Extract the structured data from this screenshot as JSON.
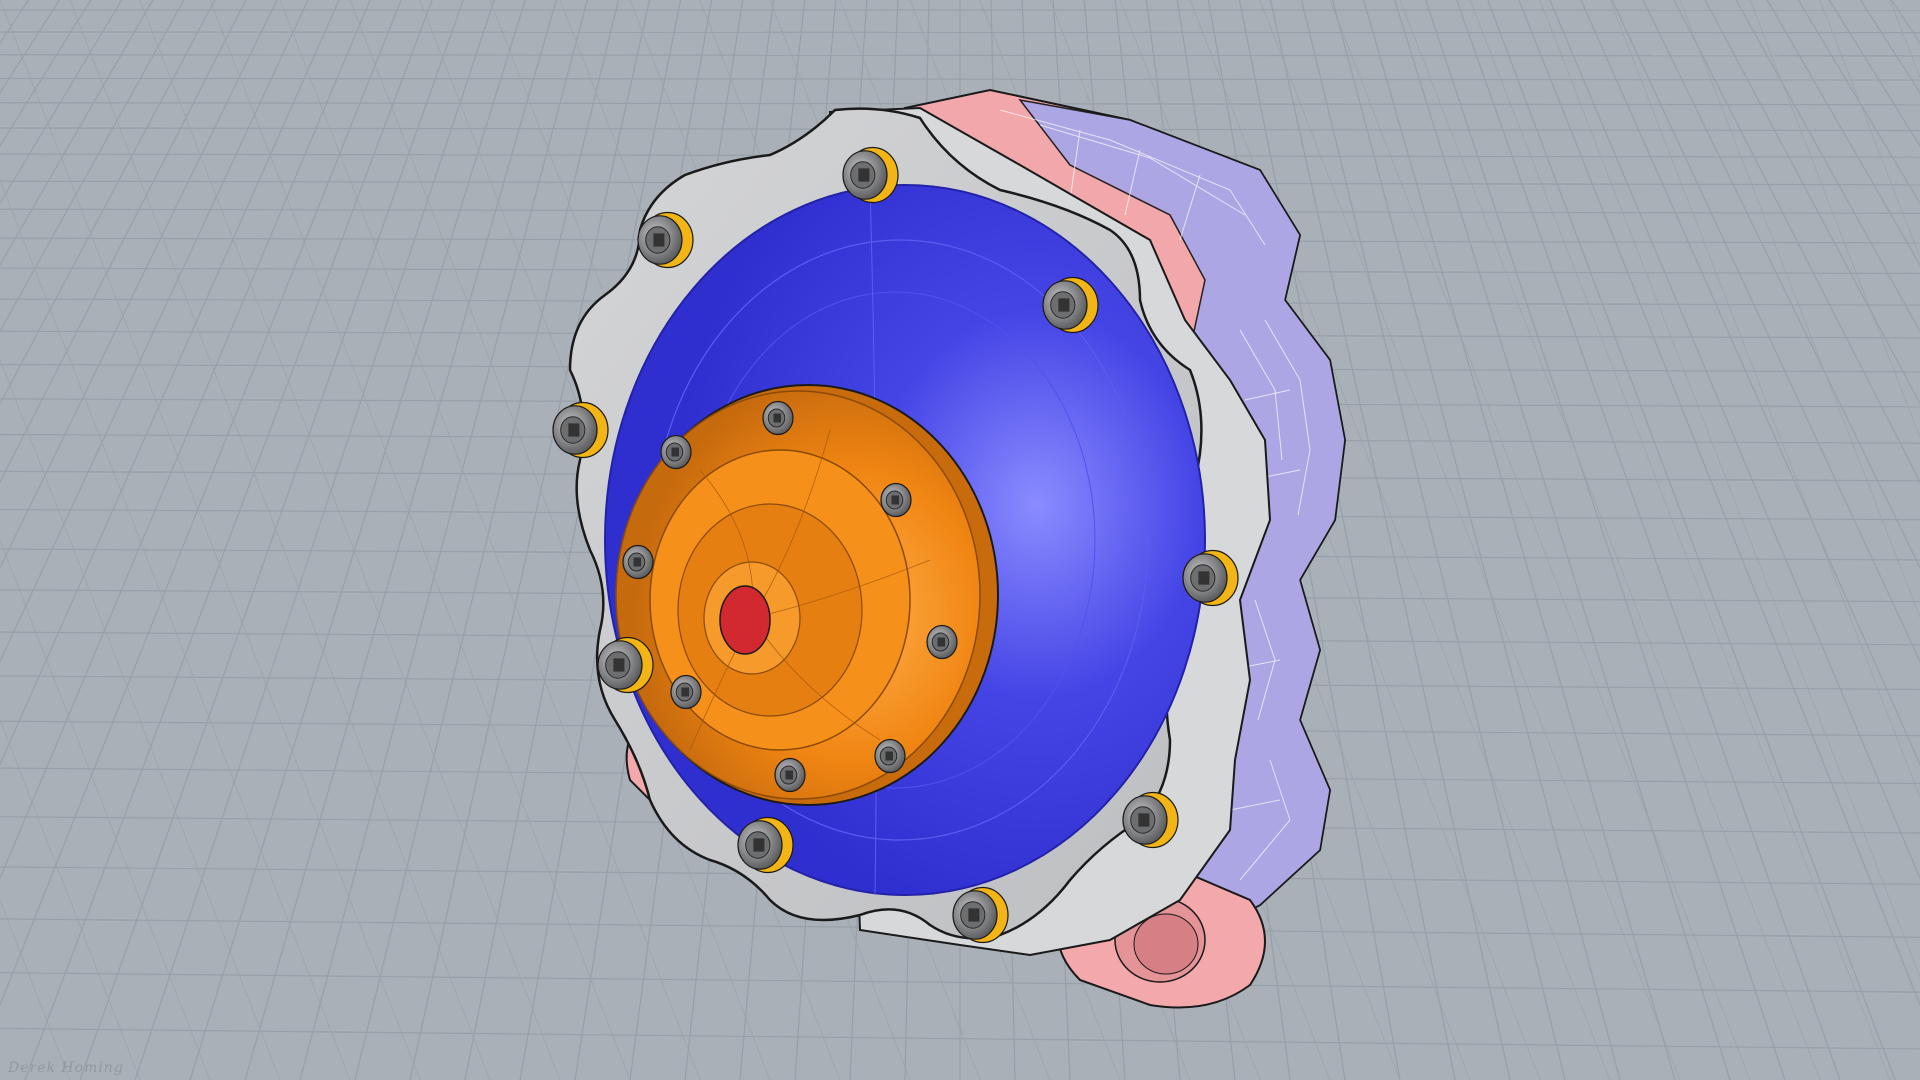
{
  "viewport": {
    "background": "#a9b0b7",
    "grid_color": "#8f969e",
    "grid_minor_color": "#9ea5ac"
  },
  "model": {
    "plate_color": "#c9cacc",
    "rotor_color": "#3535d8",
    "rotor_highlight": "#7a7cff",
    "hub_color": "#f28a14",
    "hub_dark": "#c8690c",
    "center_color": "#d2282f",
    "caliper_pink": "#f2a5a8",
    "caliper_blue": "#a6a4e6",
    "bolt_gray": "#8e8f91",
    "bolt_ring": "#f2b515",
    "edge_color": "#1a1a1a"
  },
  "signature": {
    "text": "Derek Homing"
  },
  "icons": {
    "outer_bolt": "bolt-icon",
    "hub_bolt": "hub-bolt-icon"
  }
}
